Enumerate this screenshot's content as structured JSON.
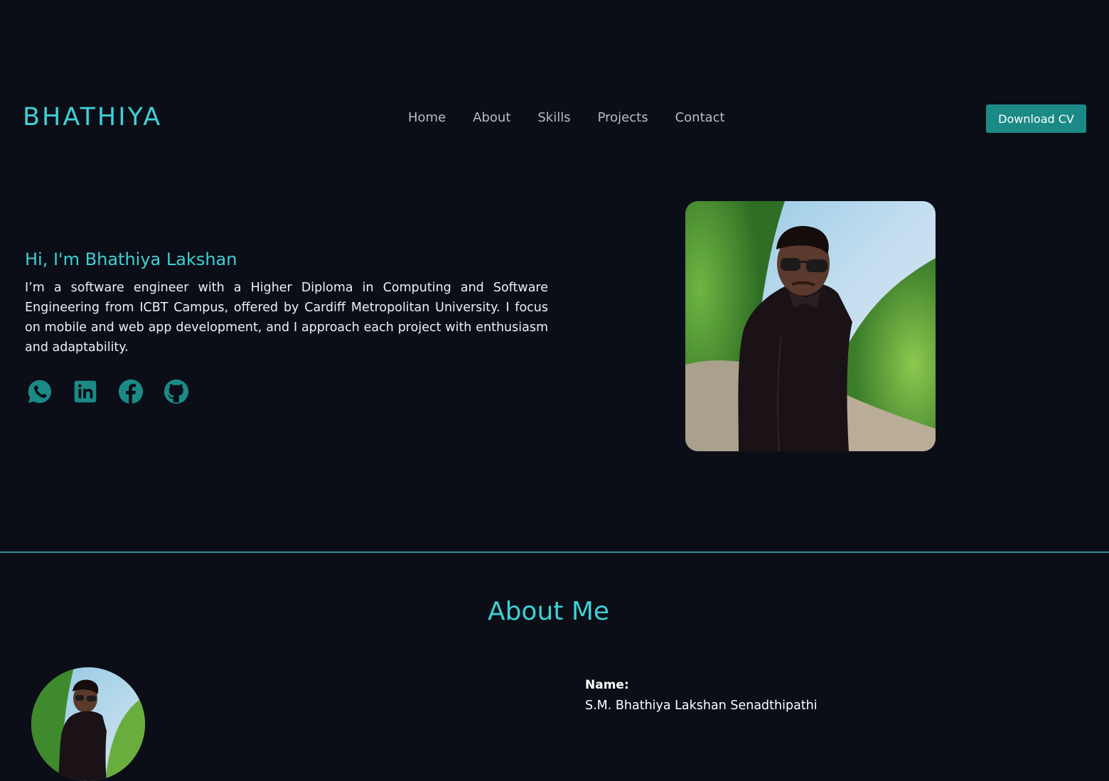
{
  "navbar": {
    "brand": "BHATHIYA",
    "links": [
      "Home",
      "About",
      "Skills",
      "Projects",
      "Contact"
    ],
    "cv_button": "Download CV"
  },
  "hero": {
    "greeting": "Hi, I'm Bhathiya Lakshan",
    "description": "I’m a software engineer with a Higher Diploma in Computing and Software Engineering from ICBT Campus, offered by Cardiff Metropolitan University. I focus on mobile and web app development, and I approach each project with enthusiasm and adaptability.",
    "socials": [
      "whatsapp-icon",
      "linkedin-icon",
      "facebook-icon",
      "github-icon"
    ]
  },
  "about": {
    "title": "About Me",
    "name_label": "Name:",
    "name_value": "S.M. Bhathiya Lakshan Senadthipathi"
  },
  "colors": {
    "background": "#0b0e17",
    "accent": "#3fd0d4",
    "button": "#1b8a86",
    "icon": "#1b8a86"
  }
}
